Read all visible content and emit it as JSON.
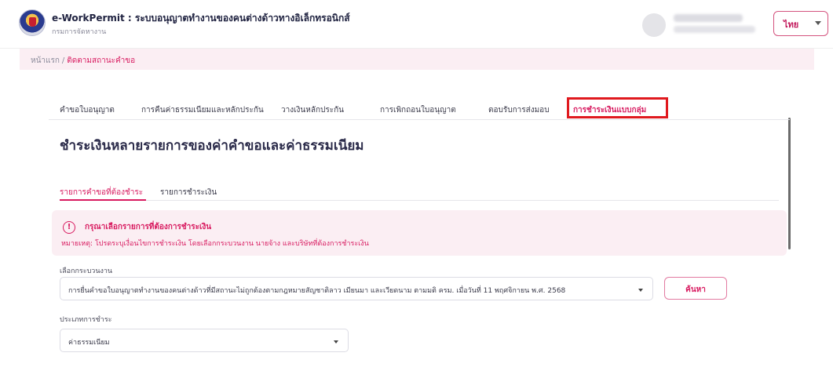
{
  "header": {
    "app_title": "e-WorkPermit : ระบบอนุญาตทำงานของคนต่างด้าวทางอิเล็กทรอนิกส์",
    "app_subtitle": "กรมการจัดหางาน",
    "language": "ไทย"
  },
  "breadcrumb": {
    "home": "หน้าแรก",
    "separator": "/",
    "current": "ติดตามสถานะคำขอ"
  },
  "tabs": [
    {
      "label": "คำขอใบอนุญาต"
    },
    {
      "label": "การคืนค่าธรรมเนียมและหลักประกัน"
    },
    {
      "label": "วางเงินหลักประกัน"
    },
    {
      "label": "การเพิกถอนใบอนุญาต"
    },
    {
      "label": "ตอบรับการส่งมอบ"
    },
    {
      "label": "การชำระเงินแบบกลุ่ม",
      "active": true,
      "highlighted": true
    }
  ],
  "page_heading": "ชำระเงินหลายรายการของค่าคำขอและค่าธรรมเนียม",
  "subtabs": [
    {
      "label": "รายการคำขอที่ต้องชำระ",
      "active": true
    },
    {
      "label": "รายการชำระเงิน"
    }
  ],
  "alert": {
    "icon": "info-icon",
    "title": "กรุณาเลือกรายการที่ต้องการชำระเงิน",
    "text": "หมายเหตุ: โปรดระบุเงื่อนไขการชำระเงิน โดยเลือกกระบวนงาน นายจ้าง และบริษัทที่ต้องการชำระเงิน"
  },
  "form": {
    "process_label": "เลือกกระบวนงาน",
    "process_value": "การยื่นคำขอใบอนุญาตทำงานของคนต่างด้าวที่มีสถานะไม่ถูกต้องตามกฎหมายสัญชาติลาว เมียนมา และเวียดนาม ตามมติ ครม. เมื่อวันที่ 11 พฤศจิกายน พ.ศ. 2568",
    "search_button": "ค้นหา",
    "payment_type_label": "ประเภทการชำระ",
    "payment_type_value": "ค่าธรรมเนียม"
  },
  "colors": {
    "accent": "#d81b60",
    "alert_bg": "#fbeef3",
    "highlight_box": "#e0191e"
  }
}
